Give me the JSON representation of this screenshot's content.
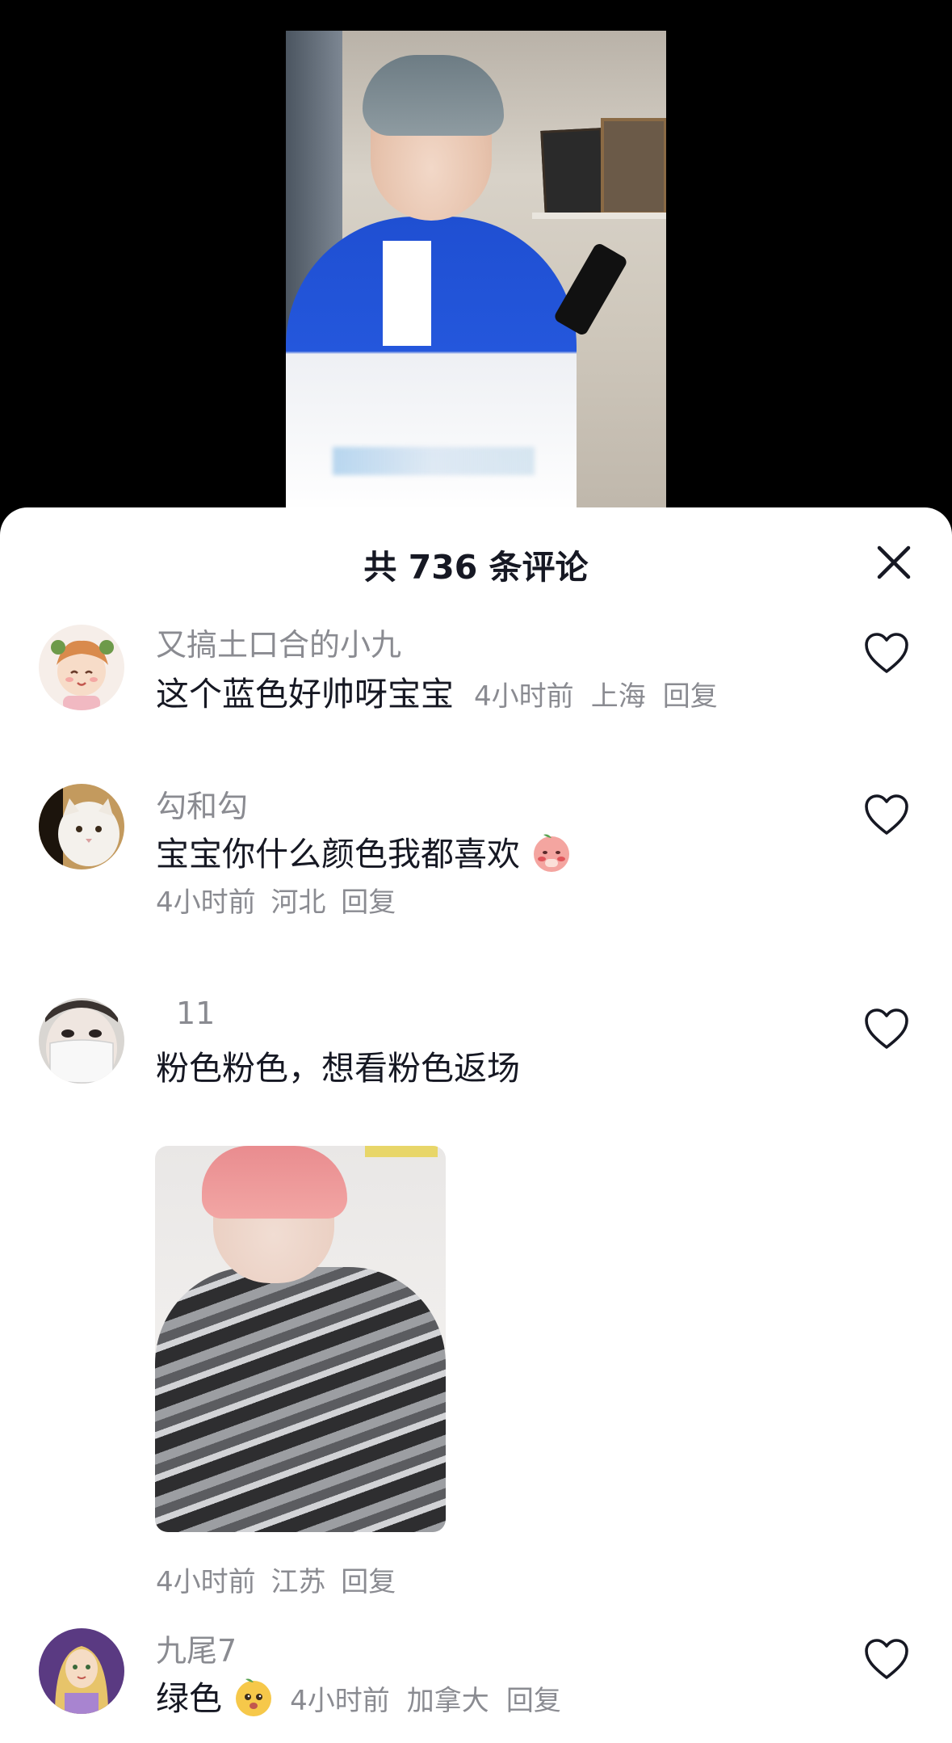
{
  "sheet": {
    "title": "共 736 条评论"
  },
  "comments": [
    {
      "username": "又搞土口合的小九",
      "text": "这个蓝色好帅呀宝宝",
      "time": "4小时前",
      "location": "上海",
      "reply_label": "回复",
      "avatar_icon": "cartoon-girl-avatar"
    },
    {
      "username": "勾和勾",
      "text": "宝宝你什么颜色我都喜欢",
      "emoji": "blushing-peach-emoji",
      "time": "4小时前",
      "location": "河北",
      "reply_label": "回复",
      "avatar_icon": "white-cat-avatar"
    },
    {
      "username": "11",
      "text": "粉色粉色，想看粉色返场",
      "time": "4小时前",
      "location": "江苏",
      "reply_label": "回复",
      "avatar_icon": "masked-person-avatar",
      "image": "pink-haired-person-photo"
    },
    {
      "username": "九尾7",
      "text": "绿色",
      "emoji": "yellow-peach-emoji",
      "time": "4小时前",
      "location": "加拿大",
      "reply_label": "回复",
      "avatar_icon": "princess-avatar"
    }
  ],
  "colors": {
    "accent_text": "#161823",
    "meta_text": "#8a8b91",
    "background": "#ffffff"
  }
}
